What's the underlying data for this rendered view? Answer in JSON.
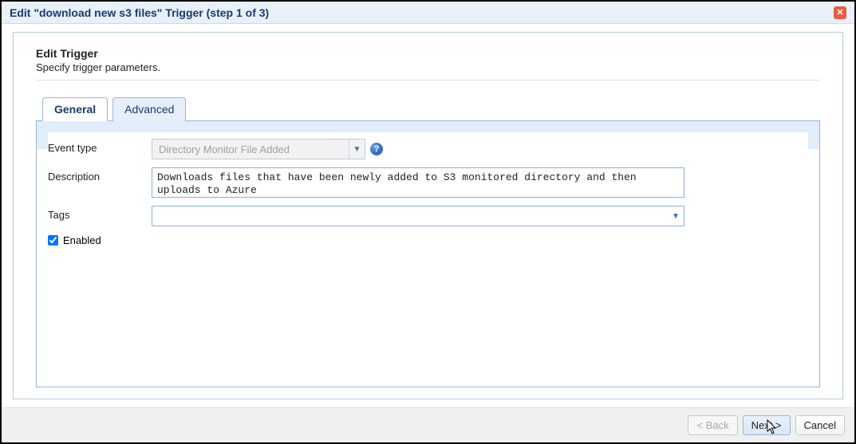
{
  "window": {
    "title": "Edit \"download new s3 files\" Trigger (step 1 of 3)"
  },
  "header": {
    "title": "Edit Trigger",
    "subtitle": "Specify trigger parameters."
  },
  "tabs": {
    "general": "General",
    "advanced": "Advanced"
  },
  "form": {
    "event_type_label": "Event type",
    "event_type_value": "Directory Monitor File Added",
    "description_label": "Description",
    "description_value": "Downloads files that have been newly added to S3 monitored directory and then uploads to Azure",
    "tags_label": "Tags",
    "tags_value": "",
    "enabled_label": "Enabled",
    "enabled_checked": true
  },
  "footer": {
    "back": "< Back",
    "next": "Next >",
    "cancel": "Cancel"
  }
}
